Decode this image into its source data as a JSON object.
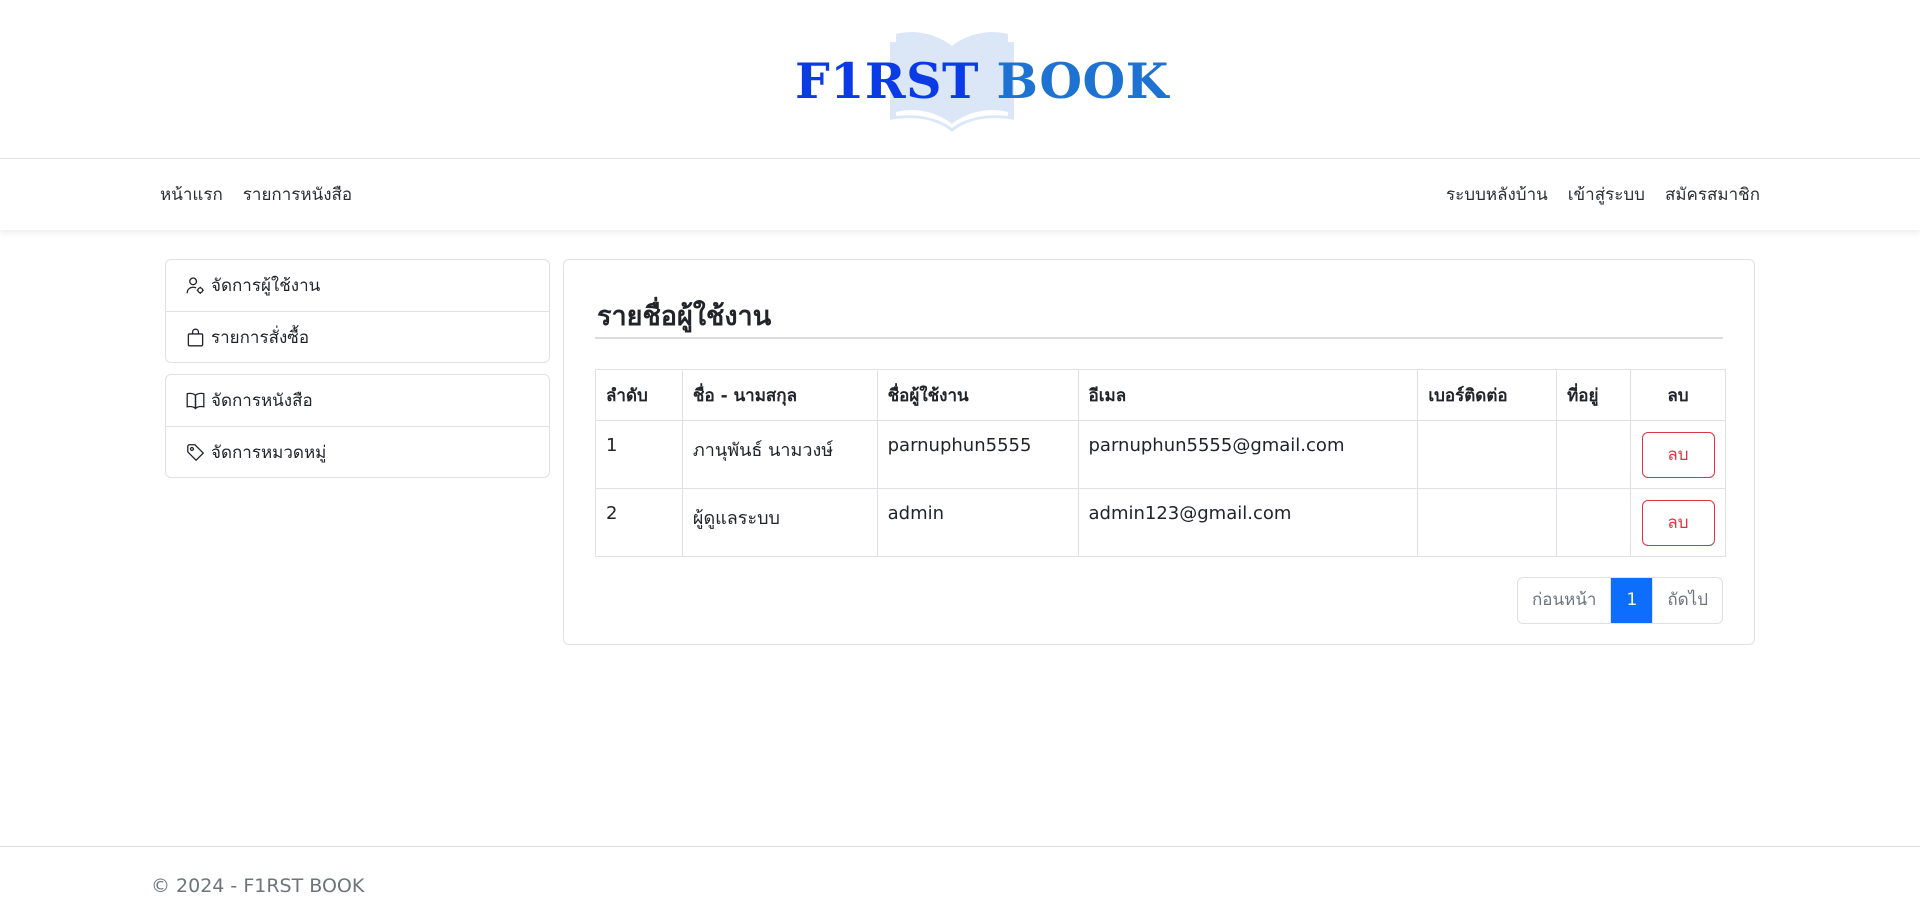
{
  "brand": {
    "part1": "F1RST",
    "part2": "BOOK",
    "color_primary": "#0b3be5",
    "color_secondary": "#1e73d2"
  },
  "navbar": {
    "left": [
      {
        "label": "หน้าแรก"
      },
      {
        "label": "รายการหนังสือ"
      }
    ],
    "right": [
      {
        "label": "ระบบหลังบ้าน"
      },
      {
        "label": "เข้าสู่ระบบ"
      },
      {
        "label": "สมัครสมาชิก"
      }
    ]
  },
  "sidebar": {
    "group1": [
      {
        "label": "จัดการผู้ใช้งาน",
        "icon": "person-gear-icon"
      },
      {
        "label": "รายการสั่งซื้อ",
        "icon": "bag-icon"
      }
    ],
    "group2": [
      {
        "label": "จัดการหนังสือ",
        "icon": "book-icon"
      },
      {
        "label": "จัดการหมวดหมู่",
        "icon": "tag-icon"
      }
    ]
  },
  "main": {
    "title": "รายชื่อผู้ใช้งาน",
    "table": {
      "headers": [
        "ลำดับ",
        "ชื่อ - นามสกุล",
        "ชื่อผู้ใช้งาน",
        "อีเมล",
        "เบอร์ติดต่อ",
        "ที่อยู่",
        "ลบ"
      ],
      "rows": [
        {
          "no": "1",
          "name": "ภานุพันธ์ นามวงษ์",
          "username": "parnuphun5555",
          "email": "parnuphun5555@gmail.com",
          "phone": "",
          "address": "",
          "delete": "ลบ"
        },
        {
          "no": "2",
          "name": "ผู้ดูแลระบบ",
          "username": "admin",
          "email": "admin123@gmail.com",
          "phone": "",
          "address": "",
          "delete": "ลบ"
        }
      ]
    },
    "pagination": {
      "prev": "ก่อนหน้า",
      "current": "1",
      "next": "ถัดไป"
    }
  },
  "footer": {
    "text": "© 2024 - F1RST BOOK"
  },
  "colors": {
    "accent": "#0d6efd",
    "danger": "#dc3545"
  }
}
